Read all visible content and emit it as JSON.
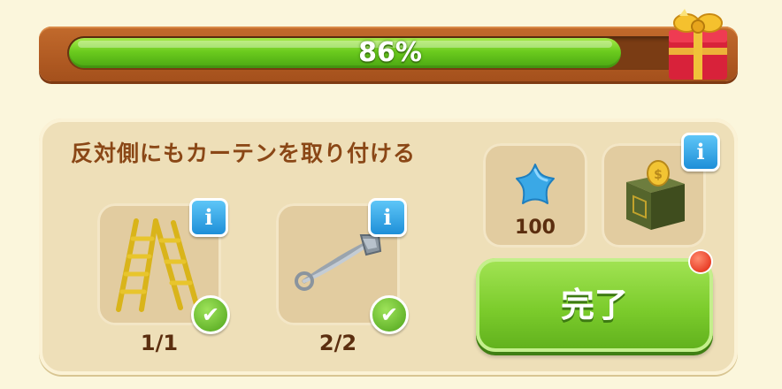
{
  "progress": {
    "percent_label": "86%",
    "fraction": 0.86,
    "fill_color": "#6bcb1e"
  },
  "task": {
    "title": "反対側にもカーテンを取り付ける",
    "requirements": [
      {
        "item": "ladder-icon",
        "count_label": "1/1",
        "completed": true
      },
      {
        "item": "safety-pin-icon",
        "count_label": "2/2",
        "completed": true
      }
    ]
  },
  "rewards": [
    {
      "item": "blue-star-icon",
      "amount_label": "100"
    },
    {
      "item": "coin-chest-icon",
      "amount_label": ""
    }
  ],
  "actions": {
    "complete_label": "完了",
    "has_alert": true,
    "accent_color": "#7ccc2c"
  },
  "icons": {
    "info_glyph": "i",
    "check_glyph": "✔"
  }
}
